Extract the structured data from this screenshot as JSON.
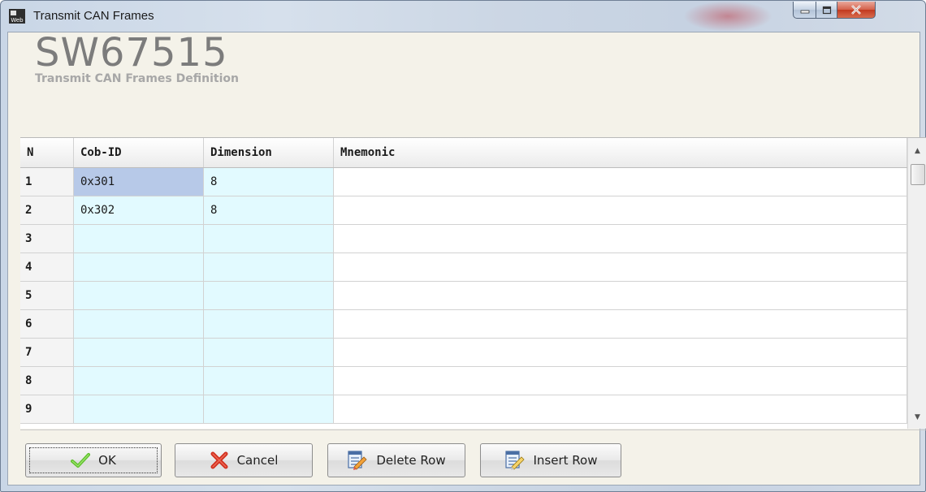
{
  "window": {
    "title": "Transmit CAN Frames",
    "app_icon": "web-app-icon",
    "controls": {
      "minimize_icon": "minimize-icon",
      "maximize_icon": "maximize-icon",
      "close_icon": "close-icon"
    }
  },
  "header": {
    "title": "SW67515",
    "subtitle": "Transmit CAN Frames Definition"
  },
  "table": {
    "columns": [
      "N",
      "Cob-ID",
      "Dimension",
      "Mnemonic"
    ],
    "rows": [
      {
        "n": "1",
        "cob_id": "0x301",
        "dimension": "8",
        "mnemonic": ""
      },
      {
        "n": "2",
        "cob_id": "0x302",
        "dimension": "8",
        "mnemonic": ""
      },
      {
        "n": "3",
        "cob_id": "",
        "dimension": "",
        "mnemonic": ""
      },
      {
        "n": "4",
        "cob_id": "",
        "dimension": "",
        "mnemonic": ""
      },
      {
        "n": "5",
        "cob_id": "",
        "dimension": "",
        "mnemonic": ""
      },
      {
        "n": "6",
        "cob_id": "",
        "dimension": "",
        "mnemonic": ""
      },
      {
        "n": "7",
        "cob_id": "",
        "dimension": "",
        "mnemonic": ""
      },
      {
        "n": "8",
        "cob_id": "",
        "dimension": "",
        "mnemonic": ""
      },
      {
        "n": "9",
        "cob_id": "",
        "dimension": "",
        "mnemonic": ""
      }
    ],
    "selected_cell": "row 1, Cob-ID"
  },
  "buttons": {
    "ok": "OK",
    "cancel": "Cancel",
    "delete_row": "Delete Row",
    "insert_row": "Insert Row"
  },
  "colors": {
    "editable_cell": "#e2faff",
    "selected_cell": "#b7c9e8",
    "background": "#f4f2e9"
  }
}
